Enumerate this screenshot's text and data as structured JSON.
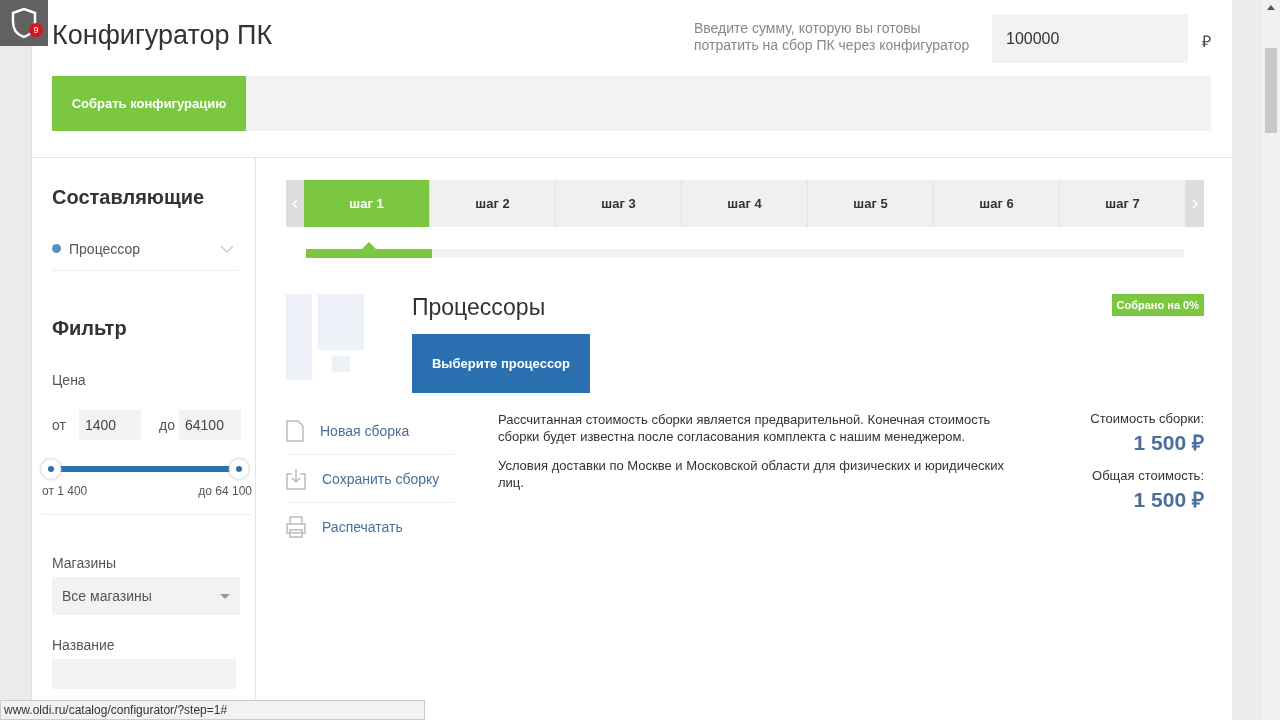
{
  "extension_badge": {
    "count": "9"
  },
  "header": {
    "title": "Конфигуратор ПК",
    "budget_hint": "Введите сумму, которую вы готовы потратить на сбор ПК через конфигуратор",
    "budget_value": "100000",
    "currency": "₽"
  },
  "build_button": "Собрать конфигурацию",
  "sidebar": {
    "components_title": "Составляющие",
    "components": [
      {
        "label": "Процессор",
        "color": "#5b8fbd",
        "expanded": false
      }
    ],
    "filter_title": "Фильтр",
    "price_label": "Цена",
    "from_label": "от",
    "from_value": "1400",
    "to_label": "до",
    "to_value": "64100",
    "range": {
      "from": {
        "level": 0
      },
      "to": {
        "level": 1
      }
    },
    "min_text": "от 1 400",
    "max_text": "до 64 100",
    "shops_label": "Магазины",
    "shops_value": "Все магазины",
    "name_label": "Название"
  },
  "steps": [
    {
      "label": "шаг 1",
      "selected": true
    },
    {
      "label": "шаг 2",
      "selected": false
    },
    {
      "label": "шаг 3",
      "selected": false
    },
    {
      "label": "шаг 4",
      "selected": false
    },
    {
      "label": "шаг 5",
      "selected": false
    },
    {
      "label": "шаг 6",
      "selected": false
    },
    {
      "label": "шаг 7",
      "selected": false
    }
  ],
  "progress": {
    "level": 0.144
  },
  "section": {
    "title": "Процессоры",
    "choose_button": "Выберите процессор",
    "badge": "Собрано на 0%"
  },
  "actions": [
    {
      "kind": "new",
      "label": "Новая сборка"
    },
    {
      "kind": "save",
      "label": "Сохранить сборку"
    },
    {
      "kind": "print",
      "label": "Распечатать"
    }
  ],
  "notes": [
    "Рассчитанная стоимость сборки является предварительной. Конечная стоимость сборки будет известна после согласования комплекта с нашим менеджером.",
    "Условия доставки по Москве и Московской области для физических и юридических лиц."
  ],
  "totals": [
    {
      "label": "Стоимость сборки:",
      "value": "1 500 ₽"
    },
    {
      "label": "Общая стоимость:",
      "value": "1 500 ₽"
    }
  ],
  "status_url": "www.oldi.ru/catalog/configurator/?step=1#"
}
